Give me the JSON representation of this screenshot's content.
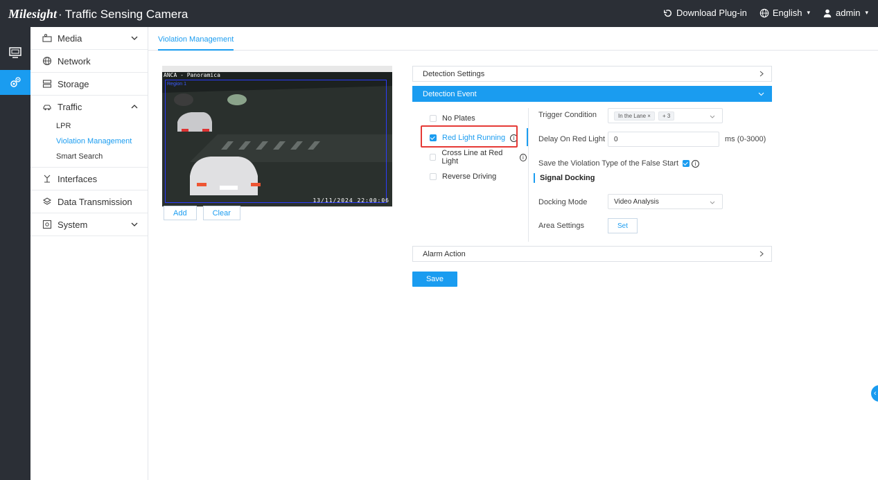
{
  "header": {
    "brand_logo": "Milesight",
    "brand_title": "Traffic Sensing Camera",
    "download_plugin": "Download Plug-in",
    "language": "English",
    "user": "admin"
  },
  "sidebar": {
    "items": [
      {
        "label": "Media",
        "icon": "media-icon"
      },
      {
        "label": "Network",
        "icon": "globe-icon"
      },
      {
        "label": "Storage",
        "icon": "storage-icon"
      },
      {
        "label": "Traffic",
        "icon": "car-icon"
      },
      {
        "label": "Interfaces",
        "icon": "interfaces-icon"
      },
      {
        "label": "Data Transmission",
        "icon": "data-transmission-icon"
      },
      {
        "label": "System",
        "icon": "system-icon"
      }
    ],
    "traffic_sub": [
      "LPR",
      "Violation Management",
      "Smart Search"
    ]
  },
  "main": {
    "tab": "Violation Management",
    "video": {
      "label": "ANCA - Panoramica",
      "timestamp": "13/11/2024 22:00:06",
      "roi_tag": "Region 1"
    },
    "video_buttons": {
      "add": "Add",
      "clear": "Clear"
    },
    "panels": {
      "detection_settings": "Detection Settings",
      "detection_event": "Detection Event",
      "alarm_action": "Alarm Action"
    },
    "events": [
      "No Plates",
      "Red Light Running",
      "Cross Line at Red Light",
      "Reverse Driving"
    ],
    "form": {
      "trigger_condition_label": "Trigger Condition",
      "trigger_tag": "In the Lane",
      "trigger_more": "+ 3",
      "delay_label": "Delay On Red Light",
      "delay_value": "0",
      "delay_unit": "ms (0-3000)",
      "false_start_label": "Save the Violation Type of the False Start",
      "signal_docking_title": "Signal Docking",
      "docking_mode_label": "Docking Mode",
      "docking_mode_value": "Video Analysis",
      "area_settings_label": "Area Settings",
      "set_button": "Set"
    },
    "save_button": "Save"
  },
  "colors": {
    "accent": "#1a9cf0",
    "topbar": "#2b2f36",
    "highlight": "#e53935"
  }
}
